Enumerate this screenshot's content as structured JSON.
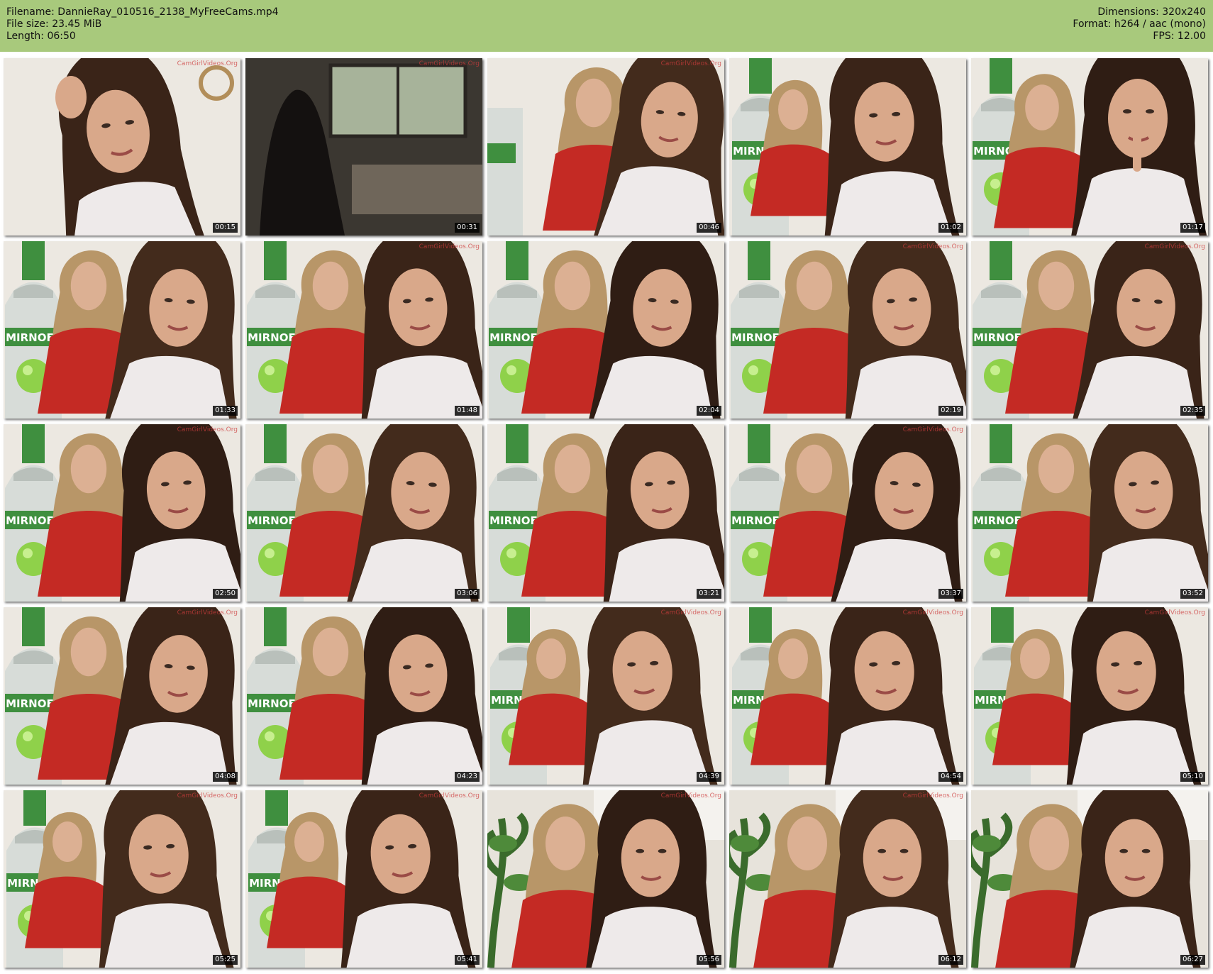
{
  "header": {
    "filename": "Filename: DannieRay_010516_2138_MyFreeCams.mp4",
    "filesize": "File size: 23.45 MiB",
    "length": "Length: 06:50",
    "dimensions": "Dimensions: 320x240",
    "format": "Format: h264 / aac (mono)",
    "fps": "FPS: 12.00"
  },
  "colors": {
    "header_bg": "#a8c97c",
    "sweater_red": "#c42a24",
    "bottle_green": "#3f8f3f"
  },
  "thumbnails": [
    {
      "time": "00:15",
      "scene": "closeup-hand",
      "watermark": true
    },
    {
      "time": "00:31",
      "scene": "dark-room",
      "watermark": true
    },
    {
      "time": "00:46",
      "scene": "two-girls-bottle-side",
      "watermark": true
    },
    {
      "time": "01:02",
      "scene": "bottle-girl-center",
      "watermark": false
    },
    {
      "time": "01:17",
      "scene": "bottle-girl-finger",
      "watermark": false
    },
    {
      "time": "01:33",
      "scene": "bottle-two-girls",
      "watermark": false
    },
    {
      "time": "01:48",
      "scene": "bottle-two-girls",
      "watermark": true
    },
    {
      "time": "02:04",
      "scene": "bottle-two-girls",
      "watermark": false
    },
    {
      "time": "02:19",
      "scene": "bottle-two-girls",
      "watermark": true
    },
    {
      "time": "02:35",
      "scene": "bottle-two-girls",
      "watermark": true
    },
    {
      "time": "02:50",
      "scene": "bottle-two-girls",
      "watermark": true
    },
    {
      "time": "03:06",
      "scene": "bottle-two-girls",
      "watermark": false
    },
    {
      "time": "03:21",
      "scene": "bottle-two-girls",
      "watermark": false
    },
    {
      "time": "03:37",
      "scene": "bottle-two-girls",
      "watermark": true
    },
    {
      "time": "03:52",
      "scene": "bottle-two-girls",
      "watermark": false
    },
    {
      "time": "04:08",
      "scene": "bottle-two-girls",
      "watermark": true
    },
    {
      "time": "04:23",
      "scene": "bottle-two-girls",
      "watermark": false
    },
    {
      "time": "04:39",
      "scene": "bottle-girl-center",
      "watermark": true
    },
    {
      "time": "04:54",
      "scene": "bottle-girl-center",
      "watermark": true
    },
    {
      "time": "05:10",
      "scene": "bottle-girl-center",
      "watermark": true
    },
    {
      "time": "05:25",
      "scene": "bottle-girl-center",
      "watermark": true
    },
    {
      "time": "05:41",
      "scene": "bottle-girl-center",
      "watermark": true
    },
    {
      "time": "05:56",
      "scene": "plant-two-girls",
      "watermark": true
    },
    {
      "time": "06:12",
      "scene": "plant-two-girls",
      "watermark": true
    },
    {
      "time": "06:27",
      "scene": "plant-two-girls",
      "watermark": false
    }
  ]
}
